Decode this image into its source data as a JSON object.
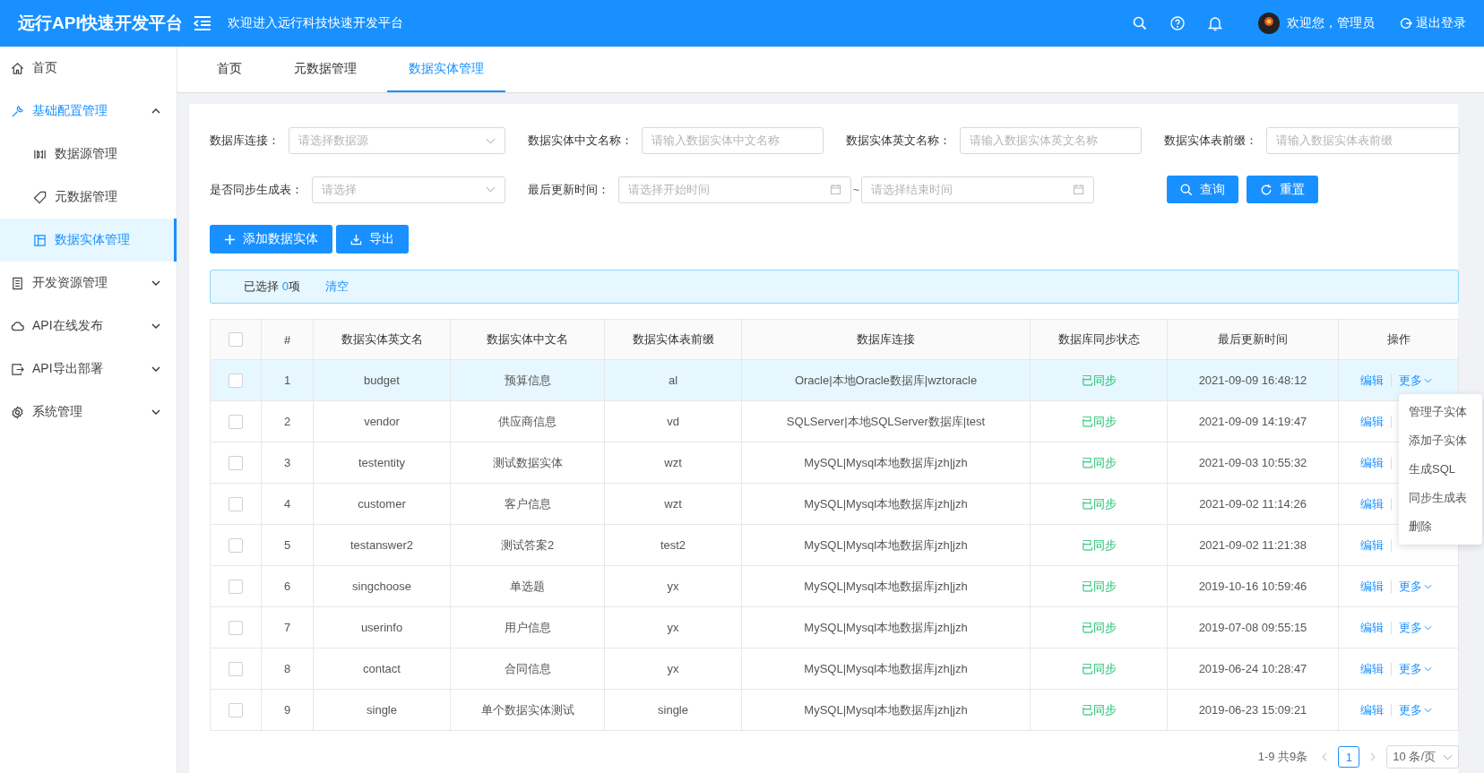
{
  "header": {
    "title": "远行API快速开发平台",
    "subtitle": "欢迎进入远行科技快速开发平台",
    "user": "欢迎您，管理员",
    "logout": "退出登录"
  },
  "sidebar": {
    "items": [
      {
        "label": "首页"
      },
      {
        "label": "基础配置管理",
        "expanded": true,
        "children": [
          {
            "label": "数据源管理",
            "selected": false
          },
          {
            "label": "元数据管理",
            "selected": false
          },
          {
            "label": "数据实体管理",
            "selected": true
          }
        ]
      },
      {
        "label": "开发资源管理",
        "expanded": false
      },
      {
        "label": "API在线发布",
        "expanded": false
      },
      {
        "label": "API导出部署",
        "expanded": false
      },
      {
        "label": "系统管理",
        "expanded": false
      }
    ]
  },
  "tabs": [
    {
      "label": "首页",
      "selected": false
    },
    {
      "label": "元数据管理",
      "selected": false
    },
    {
      "label": "数据实体管理",
      "selected": true
    }
  ],
  "filters": [
    {
      "kind": "select",
      "label": "数据库连接：",
      "placeholder": "请选择数据源"
    },
    {
      "kind": "input",
      "label": "数据实体中文名称：",
      "placeholder": "请输入数据实体中文名称"
    },
    {
      "kind": "input",
      "label": "数据实体英文名称：",
      "placeholder": "请输入数据实体英文名称"
    },
    {
      "kind": "input",
      "label": "数据实体表前缀：",
      "placeholder": "请输入数据实体表前缀"
    },
    {
      "kind": "select",
      "label": "是否同步生成表：",
      "placeholder": "请选择"
    },
    {
      "kind": "daterange",
      "label": "最后更新时间：",
      "placeholder": "请选择开始时间",
      "placeholder_end": "请选择结束时间",
      "separator": "~"
    }
  ],
  "filter_buttons": [
    "查询",
    "重置"
  ],
  "toolbar": [
    "添加数据实体",
    "导出"
  ],
  "selection": {
    "prefix": "已选择",
    "count": "0",
    "suffix": "项",
    "action": "清空"
  },
  "table": {
    "columns": [
      "#",
      "数据实体英文名",
      "数据实体中文名",
      "数据实体表前缀",
      "数据库连接",
      "数据库同步状态",
      "最后更新时间",
      "操作"
    ],
    "header_checked": false,
    "rows": [
      {
        "no": "1",
        "en": "budget",
        "cn": "预算信息",
        "prefix": "al",
        "db": "Oracle|本地Oracle数据库|wztoracle",
        "status": "已同步",
        "synced": true,
        "time": "2021-09-09 16:48:12",
        "edit": "编辑",
        "more": "更多",
        "checked": false,
        "selected": true
      },
      {
        "no": "2",
        "en": "vendor",
        "cn": "供应商信息",
        "prefix": "vd",
        "db": "SQLServer|本地SQLServer数据库|test",
        "status": "已同步",
        "synced": true,
        "time": "2021-09-09 14:19:47",
        "edit": "编辑",
        "checked": false,
        "selected": false
      },
      {
        "no": "3",
        "en": "testentity",
        "cn": "测试数据实体",
        "prefix": "wzt",
        "db": "MySQL|Mysql本地数据库jzh|jzh",
        "status": "已同步",
        "synced": true,
        "time": "2021-09-03 10:55:32",
        "edit": "编辑",
        "checked": false,
        "selected": false
      },
      {
        "no": "4",
        "en": "customer",
        "cn": "客户信息",
        "prefix": "wzt",
        "db": "MySQL|Mysql本地数据库jzh|jzh",
        "status": "已同步",
        "synced": true,
        "time": "2021-09-02 11:14:26",
        "edit": "编辑",
        "checked": false,
        "selected": false
      },
      {
        "no": "5",
        "en": "testanswer2",
        "cn": "测试答案2",
        "prefix": "test2",
        "db": "MySQL|Mysql本地数据库jzh|jzh",
        "status": "已同步",
        "synced": true,
        "time": "2021-09-02 11:21:38",
        "edit": "编辑",
        "checked": false,
        "selected": false
      },
      {
        "no": "6",
        "en": "singchoose",
        "cn": "单选题",
        "prefix": "yx",
        "db": "MySQL|Mysql本地数据库jzh|jzh",
        "status": "已同步",
        "synced": true,
        "time": "2019-10-16 10:59:46",
        "edit": "编辑",
        "more": "更多",
        "checked": false,
        "selected": false
      },
      {
        "no": "7",
        "en": "userinfo",
        "cn": "用户信息",
        "prefix": "yx",
        "db": "MySQL|Mysql本地数据库jzh|jzh",
        "status": "已同步",
        "synced": true,
        "time": "2019-07-08 09:55:15",
        "edit": "编辑",
        "more": "更多",
        "checked": false,
        "selected": false
      },
      {
        "no": "8",
        "en": "contact",
        "cn": "合同信息",
        "prefix": "yx",
        "db": "MySQL|Mysql本地数据库jzh|jzh",
        "status": "已同步",
        "synced": true,
        "time": "2019-06-24 10:28:47",
        "edit": "编辑",
        "more": "更多",
        "checked": false,
        "selected": false
      },
      {
        "no": "9",
        "en": "single",
        "cn": "单个数据实体测试",
        "prefix": "single",
        "db": "MySQL|Mysql本地数据库jzh|jzh",
        "status": "已同步",
        "synced": true,
        "time": "2019-06-23 15:09:21",
        "edit": "编辑",
        "more": "更多",
        "checked": false,
        "selected": false
      }
    ]
  },
  "more_menu": {
    "items": [
      "管理子实体",
      "添加子实体",
      "生成SQL",
      "同步生成表",
      "删除"
    ]
  },
  "pagination": {
    "total": "1-9 共9条",
    "pages": [
      {
        "label": "1",
        "selected": true
      }
    ],
    "page_size": "10 条/页"
  }
}
